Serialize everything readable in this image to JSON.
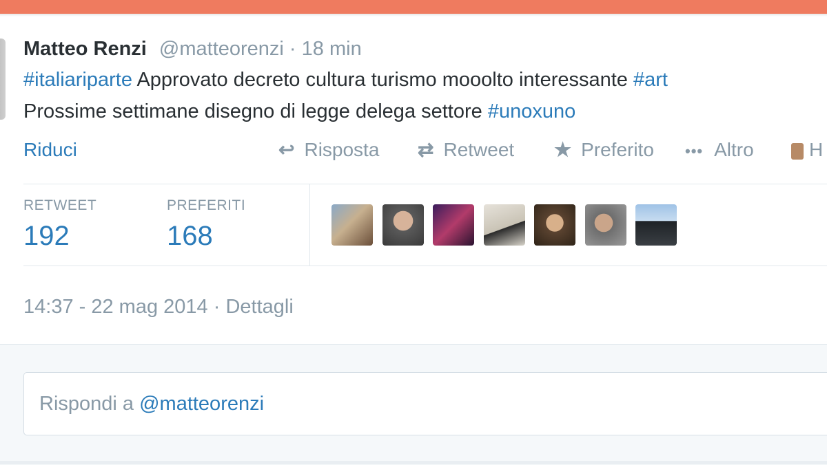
{
  "colors": {
    "accent": "#2b7bb9",
    "topbar": "#ef7b5f",
    "muted": "#8899a6",
    "text": "#292f33"
  },
  "tweet": {
    "author_name": "Matteo Renzi",
    "author_handle": "@matteorenzi",
    "separator": "·",
    "time_ago": "18 min",
    "line1": {
      "hashtag1": "#italiariparte",
      "text": " Approvato decreto cultura turismo mooolto interessante ",
      "hashtag2": "#art"
    },
    "line2": {
      "text": "Prossime settimane disegno di legge delega settore ",
      "hashtag": "#unoxuno"
    }
  },
  "actions": {
    "collapse": "Riduci",
    "reply": {
      "label": "Risposta",
      "icon": "reply-arrow-icon"
    },
    "retweet": {
      "label": "Retweet",
      "icon": "retweet-icon"
    },
    "favorite": {
      "label": "Preferito",
      "icon": "star-icon"
    },
    "more": {
      "label": "Altro",
      "icon": "more-dots-icon"
    },
    "extra": {
      "label": "H",
      "icon": "extra-icon"
    }
  },
  "stats": {
    "retweets": {
      "label": "RETWEET",
      "value": "192"
    },
    "favorites": {
      "label": "PREFERITI",
      "value": "168"
    }
  },
  "timestamp": {
    "datetime": "14:37 - 22 mag 2014",
    "separator": "·",
    "details": "Dettagli"
  },
  "reply_box": {
    "prefix": "Rispondi a ",
    "mention": "@matteorenzi"
  }
}
